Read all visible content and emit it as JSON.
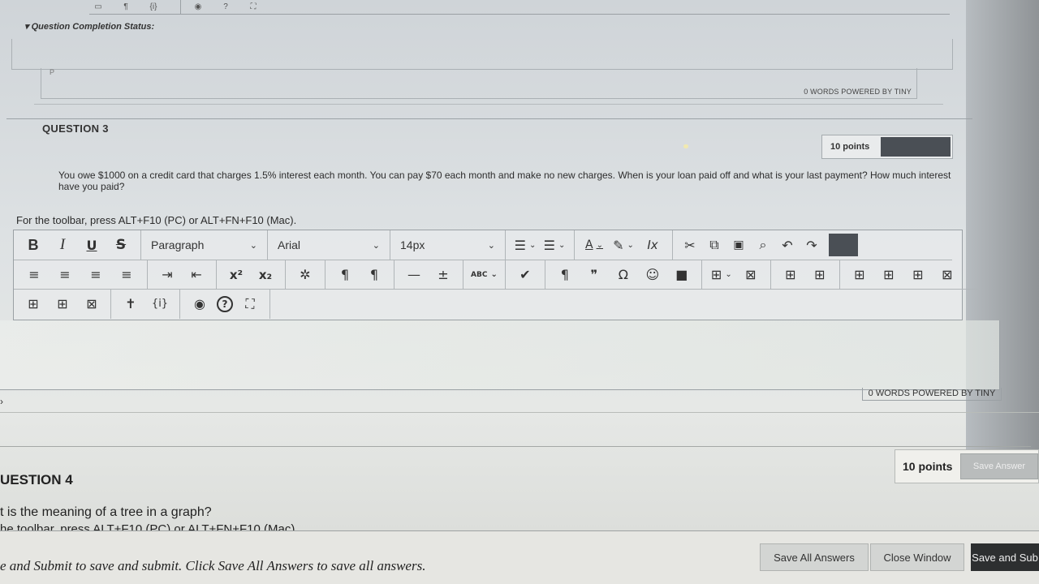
{
  "top_toolbar": {
    "icons": [
      "image-icon",
      "paragraph-mark-icon",
      "braces-icon",
      "preview-icon",
      "help-icon",
      "fullscreen-icon"
    ],
    "labels": [
      "",
      "¶",
      "{i}",
      "",
      "?",
      ""
    ]
  },
  "previous_question": {
    "status_label": "▾ Question Completion Status:",
    "path_label": "P",
    "word_count": "0 WORDS POWERED BY TINY"
  },
  "question3": {
    "title": "QUESTION 3",
    "points": "10 points",
    "text": "You owe $1000 on a credit card that charges 1.5% interest each month. You can pay $70 each month and make no new charges. When is your loan paid off and what is your last payment? How much interest have you paid?",
    "toolbar_hint": "For the toolbar, press ALT+F10 (PC) or ALT+FN+F10 (Mac).",
    "word_count": "0 WORDS POWERED BY TINY"
  },
  "editor_toolbar": {
    "row1": {
      "format_buttons": [
        {
          "name": "bold-button",
          "label": "B"
        },
        {
          "name": "italic-button",
          "label": "I"
        },
        {
          "name": "underline-button",
          "label": "U"
        },
        {
          "name": "strikethrough-button",
          "label": "S"
        }
      ],
      "block_format": "Paragraph",
      "font_family": "Arial",
      "font_size": "14px",
      "list_buttons": [
        {
          "name": "bullet-list-button",
          "label": "☰"
        },
        {
          "name": "numbered-list-button",
          "label": "☰"
        }
      ],
      "color_buttons": [
        {
          "name": "text-color-button",
          "label": "A"
        },
        {
          "name": "highlight-color-button",
          "label": "✎"
        }
      ],
      "clear_format_label": "Ix",
      "tools": [
        {
          "name": "cut-icon",
          "label": "✂"
        },
        {
          "name": "copy-icon",
          "label": "⧉"
        },
        {
          "name": "paste-icon",
          "label": "📋"
        },
        {
          "name": "search-icon",
          "label": "🔍"
        },
        {
          "name": "undo-icon",
          "label": "↶"
        },
        {
          "name": "redo-icon",
          "label": "↷"
        }
      ]
    },
    "row2": {
      "align": [
        {
          "name": "align-left-icon",
          "label": "≡"
        },
        {
          "name": "align-center-icon",
          "label": "≡"
        },
        {
          "name": "align-right-icon",
          "label": "≡"
        },
        {
          "name": "align-justify-icon",
          "label": "≡"
        }
      ],
      "indent": [
        {
          "name": "indent-icon",
          "label": "⇥"
        },
        {
          "name": "outdent-icon",
          "label": "⇤"
        }
      ],
      "script": [
        {
          "name": "superscript-icon",
          "label": "x²"
        },
        {
          "name": "subscript-icon",
          "label": "x₂"
        }
      ],
      "misc": [
        {
          "name": "remove-link-icon",
          "label": "✲"
        },
        {
          "name": "ltr-icon",
          "label": "¶"
        },
        {
          "name": "rtl-icon",
          "label": "¶"
        },
        {
          "name": "horizontal-rule-icon",
          "label": "—"
        },
        {
          "name": "insert-icon",
          "label": "±"
        },
        {
          "name": "spellcheck-icon",
          "label": "ABC"
        },
        {
          "name": "checkmark-icon",
          "label": "✔"
        },
        {
          "name": "show-blocks-icon",
          "label": "¶"
        },
        {
          "name": "blockquote-icon",
          "label": "❞"
        },
        {
          "name": "special-char-icon",
          "label": "Ω"
        },
        {
          "name": "emoji-icon",
          "label": "☺"
        },
        {
          "name": "bookmark-icon",
          "label": "■"
        },
        {
          "name": "table-icon",
          "label": "⊞"
        },
        {
          "name": "delete-table-icon",
          "label": "⊠"
        },
        {
          "name": "table-props-icon",
          "label": "⊞"
        },
        {
          "name": "table-cell-icon",
          "label": "⊞"
        },
        {
          "name": "table-row-before-icon",
          "label": "⊞"
        },
        {
          "name": "table-row-after-icon",
          "label": "⊞"
        },
        {
          "name": "table-col-icon",
          "label": "⊞"
        },
        {
          "name": "table-delete-row-icon",
          "label": "⊠"
        }
      ]
    },
    "row3": {
      "table": [
        {
          "name": "insert-col-before-icon",
          "label": "⊞"
        },
        {
          "name": "insert-col-after-icon",
          "label": "⊞"
        },
        {
          "name": "delete-col-icon",
          "label": "⊠"
        }
      ],
      "access": [
        {
          "name": "accessibility-icon",
          "label": "♿"
        },
        {
          "name": "braces-icon",
          "label": "{i}"
        }
      ],
      "view": [
        {
          "name": "preview-icon",
          "label": "◉"
        },
        {
          "name": "help-icon",
          "label": "?"
        },
        {
          "name": "fullscreen-icon",
          "label": "⛶"
        }
      ]
    }
  },
  "question4": {
    "title": "UESTION 4",
    "points": "10 points",
    "save_answer": "Save Answer",
    "text": "t is the meaning of a tree in a graph?",
    "toolbar_hint": "he toolbar, press ALT+F10 (PC) or ALT+FN+F10 (Mac)."
  },
  "footer": {
    "instruction": "e and Submit to save and submit. Click Save All Answers to save all answers.",
    "save_all": "Save All Answers",
    "close_window": "Close Window",
    "save_submit": "Save and Sub"
  },
  "colors": {
    "dark_swatch": "#4a4f55",
    "save_submit_bg": "#2d2f30"
  }
}
